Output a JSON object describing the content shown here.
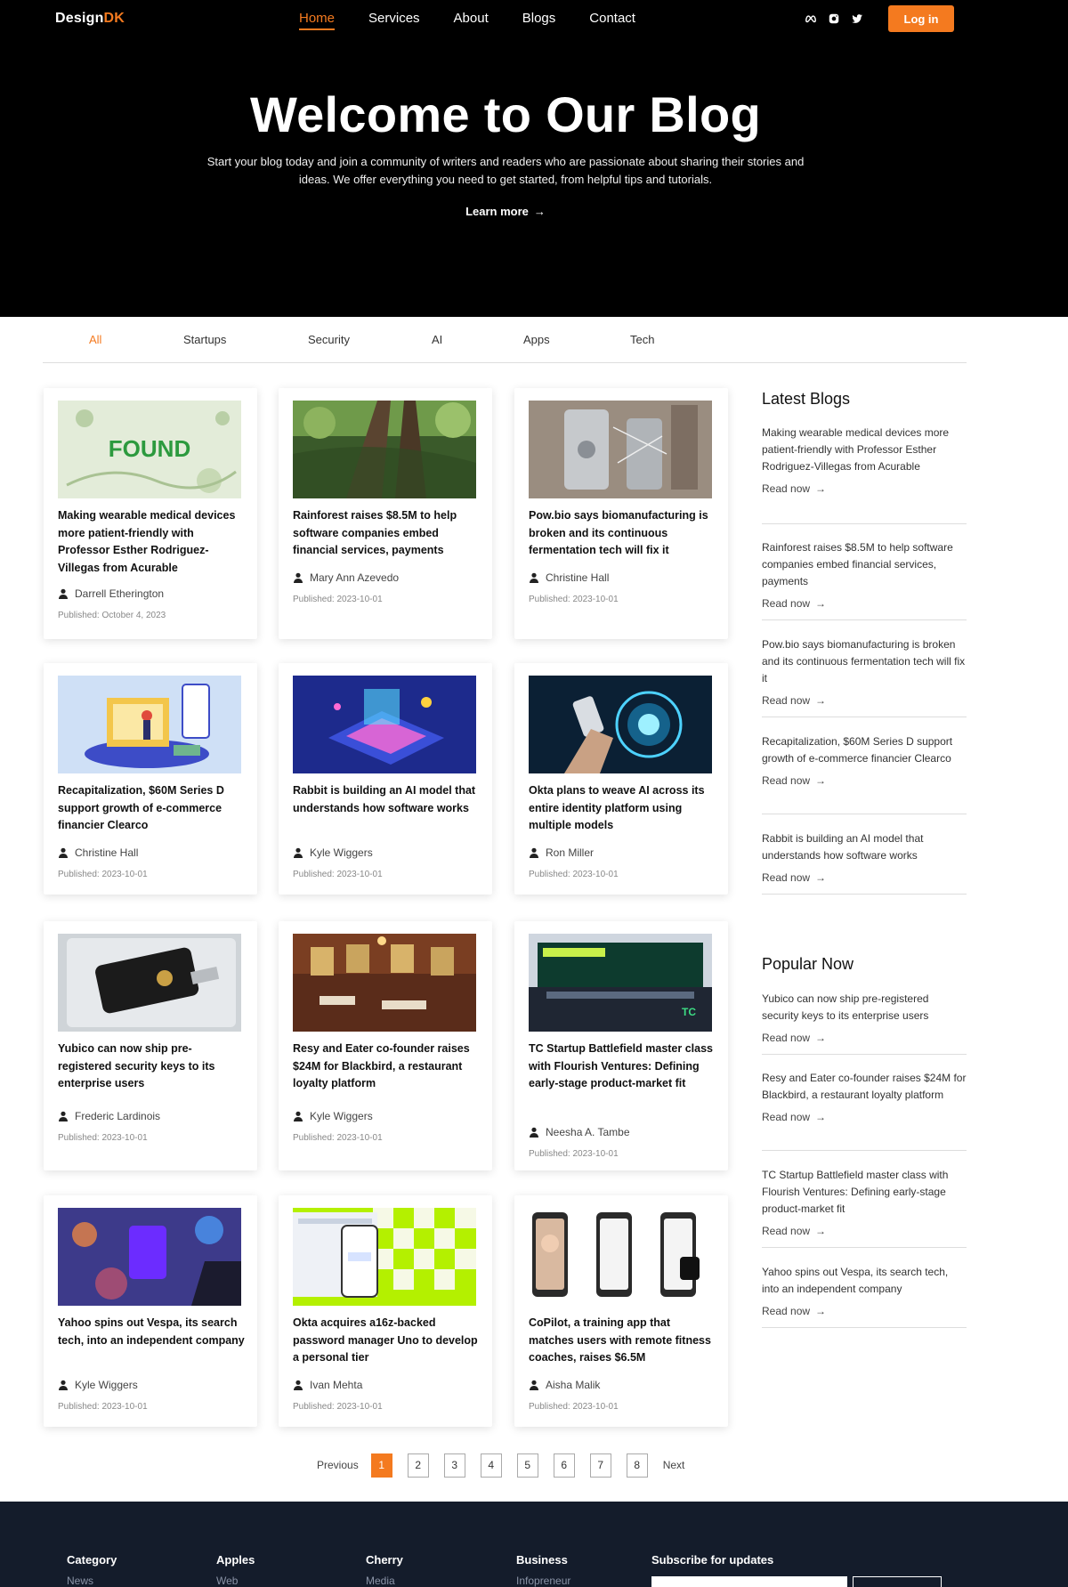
{
  "header": {
    "logo_main": "Design",
    "logo_accent": "DK",
    "nav": [
      {
        "label": "Home",
        "active": true
      },
      {
        "label": "Services",
        "active": false
      },
      {
        "label": "About",
        "active": false
      },
      {
        "label": "Blogs",
        "active": false
      },
      {
        "label": "Contact",
        "active": false
      }
    ],
    "socials": [
      "meta-icon",
      "instagram-icon",
      "twitter-icon"
    ],
    "login_label": "Log in"
  },
  "hero": {
    "title": "Welcome to Our Blog",
    "subtitle": "Start your blog today and join a community of writers and readers who are passionate about sharing their stories and ideas. We offer everything you need to get started, from helpful tips and tutorials.",
    "cta": "Learn more"
  },
  "categories": [
    "All",
    "Startups",
    "Security",
    "AI",
    "Apps",
    "Tech"
  ],
  "posts": [
    {
      "title": "Making wearable medical devices more patient-friendly with Professor Esther Rodriguez-Villegas from Acurable",
      "author": "Darrell Etherington",
      "published": "Published: October 4, 2023"
    },
    {
      "title": "Rainforest raises $8.5M to help software companies embed financial services, payments",
      "author": "Mary Ann Azevedo",
      "published": "Published: 2023-10-01"
    },
    {
      "title": "Pow.bio says biomanufacturing is broken and its continuous fermentation tech will fix it",
      "author": "Christine Hall",
      "published": "Published: 2023-10-01"
    },
    {
      "title": "Recapitalization, $60M Series D support growth of e-commerce financier Clearco",
      "author": "Christine Hall",
      "published": "Published: 2023-10-01"
    },
    {
      "title": "Rabbit is building an AI model that understands how software works",
      "author": "Kyle Wiggers",
      "published": "Published: 2023-10-01"
    },
    {
      "title": "Okta plans to weave AI across its entire identity platform using multiple models",
      "author": "Ron Miller",
      "published": "Published: 2023-10-01"
    },
    {
      "title": "Yubico can now ship pre-registered security keys to its enterprise users",
      "author": "Frederic Lardinois",
      "published": "Published: 2023-10-01"
    },
    {
      "title": "Resy and Eater co-founder raises $24M for Blackbird, a restaurant loyalty platform",
      "author": "Kyle Wiggers",
      "published": "Published: 2023-10-01"
    },
    {
      "title": "TC Startup Battlefield master class with Flourish Ventures: Defining early-stage product-market fit",
      "author": "Neesha A. Tambe",
      "published": "Published: 2023-10-01"
    },
    {
      "title": "Yahoo spins out Vespa, its search tech, into an independent company",
      "author": "Kyle Wiggers",
      "published": "Published: 2023-10-01"
    },
    {
      "title": "Okta acquires a16z-backed password manager Uno to develop a personal tier",
      "author": "Ivan Mehta",
      "published": "Published: 2023-10-01"
    },
    {
      "title": "CoPilot, a training app that matches users with remote fitness coaches, raises $6.5M",
      "author": "Aisha Malik",
      "published": "Published: 2023-10-01"
    }
  ],
  "thumb_labels": {
    "found": "FOUND",
    "tc": "TC"
  },
  "sidebar": {
    "latest_heading": "Latest Blogs",
    "latest": [
      "Making wearable medical devices more patient-friendly with Professor Esther Rodriguez-Villegas from Acurable",
      "Rainforest raises $8.5M to help software companies embed financial services, payments",
      "Pow.bio says biomanufacturing is broken and its continuous fermentation tech will fix it",
      "Recapitalization, $60M Series D support growth of e-commerce financier Clearco",
      "Rabbit is building an AI model that understands how software works"
    ],
    "popular_heading": "Popular Now",
    "popular": [
      "Yubico can now ship pre-registered security keys to its enterprise users",
      "Resy and Eater co-founder raises $24M for Blackbird, a restaurant loyalty platform",
      "TC Startup Battlefield master class with Flourish Ventures: Defining early-stage product-market fit",
      "Yahoo spins out Vespa, its search tech, into an independent company"
    ],
    "read_label": "Read now"
  },
  "pagination": {
    "previous": "Previous",
    "pages": [
      "1",
      "2",
      "3",
      "4",
      "5",
      "6",
      "7",
      "8"
    ],
    "current": "1",
    "next": "Next"
  },
  "footer": {
    "columns": [
      {
        "heading": "Category",
        "link": "News"
      },
      {
        "heading": "Apples",
        "link": "Web"
      },
      {
        "heading": "Cherry",
        "link": "Media"
      },
      {
        "heading": "Business",
        "link": "Infopreneur"
      }
    ],
    "subscribe_heading": "Subscribe for updates"
  },
  "colors": {
    "accent": "#f47a1f",
    "footer_bg": "#141c2b",
    "hero_bg": "#000000"
  }
}
